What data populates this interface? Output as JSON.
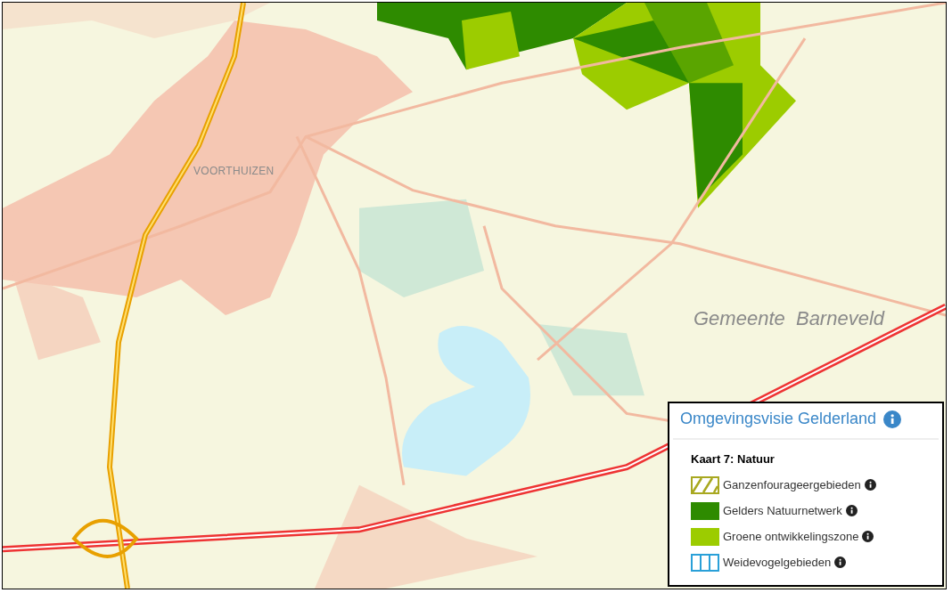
{
  "map": {
    "place_labels": [
      {
        "text": "VOORTHUIZEN",
        "kind": "town"
      },
      {
        "text": "Gemeente  Barneveld",
        "kind": "municipality"
      }
    ]
  },
  "legend": {
    "title": "Omgevingsvisie Gelderland",
    "subtitle": "Kaart 7: Natuur",
    "items": [
      {
        "label": "Ganzenfourageergebieden",
        "kind": "hatch",
        "color": "#a8a820"
      },
      {
        "label": "Gelders Natuurnetwerk",
        "kind": "solid",
        "color": "#2e8b00"
      },
      {
        "label": "Groene ontwikkelingszone",
        "kind": "solid",
        "color": "#9ccc00"
      },
      {
        "label": "Weidevogelgebieden",
        "kind": "stripes",
        "color": "#2aa0d8"
      }
    ]
  }
}
